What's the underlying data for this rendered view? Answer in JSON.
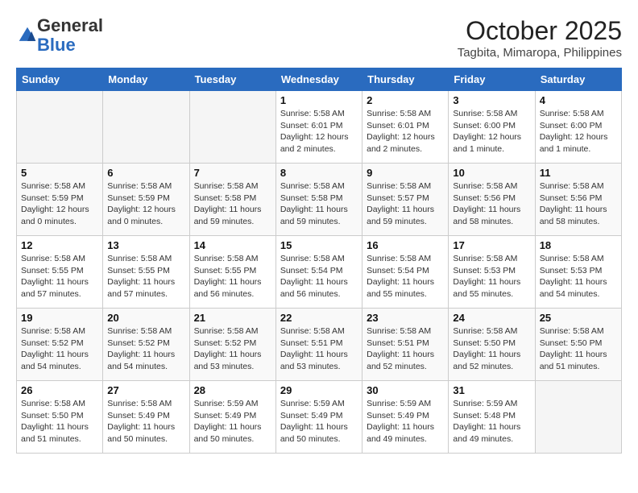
{
  "logo": {
    "general": "General",
    "blue": "Blue"
  },
  "header": {
    "month": "October 2025",
    "location": "Tagbita, Mimaropa, Philippines"
  },
  "weekdays": [
    "Sunday",
    "Monday",
    "Tuesday",
    "Wednesday",
    "Thursday",
    "Friday",
    "Saturday"
  ],
  "weeks": [
    [
      {
        "day": "",
        "info": ""
      },
      {
        "day": "",
        "info": ""
      },
      {
        "day": "",
        "info": ""
      },
      {
        "day": "1",
        "info": "Sunrise: 5:58 AM\nSunset: 6:01 PM\nDaylight: 12 hours\nand 2 minutes."
      },
      {
        "day": "2",
        "info": "Sunrise: 5:58 AM\nSunset: 6:01 PM\nDaylight: 12 hours\nand 2 minutes."
      },
      {
        "day": "3",
        "info": "Sunrise: 5:58 AM\nSunset: 6:00 PM\nDaylight: 12 hours\nand 1 minute."
      },
      {
        "day": "4",
        "info": "Sunrise: 5:58 AM\nSunset: 6:00 PM\nDaylight: 12 hours\nand 1 minute."
      }
    ],
    [
      {
        "day": "5",
        "info": "Sunrise: 5:58 AM\nSunset: 5:59 PM\nDaylight: 12 hours\nand 0 minutes."
      },
      {
        "day": "6",
        "info": "Sunrise: 5:58 AM\nSunset: 5:59 PM\nDaylight: 12 hours\nand 0 minutes."
      },
      {
        "day": "7",
        "info": "Sunrise: 5:58 AM\nSunset: 5:58 PM\nDaylight: 11 hours\nand 59 minutes."
      },
      {
        "day": "8",
        "info": "Sunrise: 5:58 AM\nSunset: 5:58 PM\nDaylight: 11 hours\nand 59 minutes."
      },
      {
        "day": "9",
        "info": "Sunrise: 5:58 AM\nSunset: 5:57 PM\nDaylight: 11 hours\nand 59 minutes."
      },
      {
        "day": "10",
        "info": "Sunrise: 5:58 AM\nSunset: 5:56 PM\nDaylight: 11 hours\nand 58 minutes."
      },
      {
        "day": "11",
        "info": "Sunrise: 5:58 AM\nSunset: 5:56 PM\nDaylight: 11 hours\nand 58 minutes."
      }
    ],
    [
      {
        "day": "12",
        "info": "Sunrise: 5:58 AM\nSunset: 5:55 PM\nDaylight: 11 hours\nand 57 minutes."
      },
      {
        "day": "13",
        "info": "Sunrise: 5:58 AM\nSunset: 5:55 PM\nDaylight: 11 hours\nand 57 minutes."
      },
      {
        "day": "14",
        "info": "Sunrise: 5:58 AM\nSunset: 5:55 PM\nDaylight: 11 hours\nand 56 minutes."
      },
      {
        "day": "15",
        "info": "Sunrise: 5:58 AM\nSunset: 5:54 PM\nDaylight: 11 hours\nand 56 minutes."
      },
      {
        "day": "16",
        "info": "Sunrise: 5:58 AM\nSunset: 5:54 PM\nDaylight: 11 hours\nand 55 minutes."
      },
      {
        "day": "17",
        "info": "Sunrise: 5:58 AM\nSunset: 5:53 PM\nDaylight: 11 hours\nand 55 minutes."
      },
      {
        "day": "18",
        "info": "Sunrise: 5:58 AM\nSunset: 5:53 PM\nDaylight: 11 hours\nand 54 minutes."
      }
    ],
    [
      {
        "day": "19",
        "info": "Sunrise: 5:58 AM\nSunset: 5:52 PM\nDaylight: 11 hours\nand 54 minutes."
      },
      {
        "day": "20",
        "info": "Sunrise: 5:58 AM\nSunset: 5:52 PM\nDaylight: 11 hours\nand 54 minutes."
      },
      {
        "day": "21",
        "info": "Sunrise: 5:58 AM\nSunset: 5:52 PM\nDaylight: 11 hours\nand 53 minutes."
      },
      {
        "day": "22",
        "info": "Sunrise: 5:58 AM\nSunset: 5:51 PM\nDaylight: 11 hours\nand 53 minutes."
      },
      {
        "day": "23",
        "info": "Sunrise: 5:58 AM\nSunset: 5:51 PM\nDaylight: 11 hours\nand 52 minutes."
      },
      {
        "day": "24",
        "info": "Sunrise: 5:58 AM\nSunset: 5:50 PM\nDaylight: 11 hours\nand 52 minutes."
      },
      {
        "day": "25",
        "info": "Sunrise: 5:58 AM\nSunset: 5:50 PM\nDaylight: 11 hours\nand 51 minutes."
      }
    ],
    [
      {
        "day": "26",
        "info": "Sunrise: 5:58 AM\nSunset: 5:50 PM\nDaylight: 11 hours\nand 51 minutes."
      },
      {
        "day": "27",
        "info": "Sunrise: 5:58 AM\nSunset: 5:49 PM\nDaylight: 11 hours\nand 50 minutes."
      },
      {
        "day": "28",
        "info": "Sunrise: 5:59 AM\nSunset: 5:49 PM\nDaylight: 11 hours\nand 50 minutes."
      },
      {
        "day": "29",
        "info": "Sunrise: 5:59 AM\nSunset: 5:49 PM\nDaylight: 11 hours\nand 50 minutes."
      },
      {
        "day": "30",
        "info": "Sunrise: 5:59 AM\nSunset: 5:49 PM\nDaylight: 11 hours\nand 49 minutes."
      },
      {
        "day": "31",
        "info": "Sunrise: 5:59 AM\nSunset: 5:48 PM\nDaylight: 11 hours\nand 49 minutes."
      },
      {
        "day": "",
        "info": ""
      }
    ]
  ]
}
